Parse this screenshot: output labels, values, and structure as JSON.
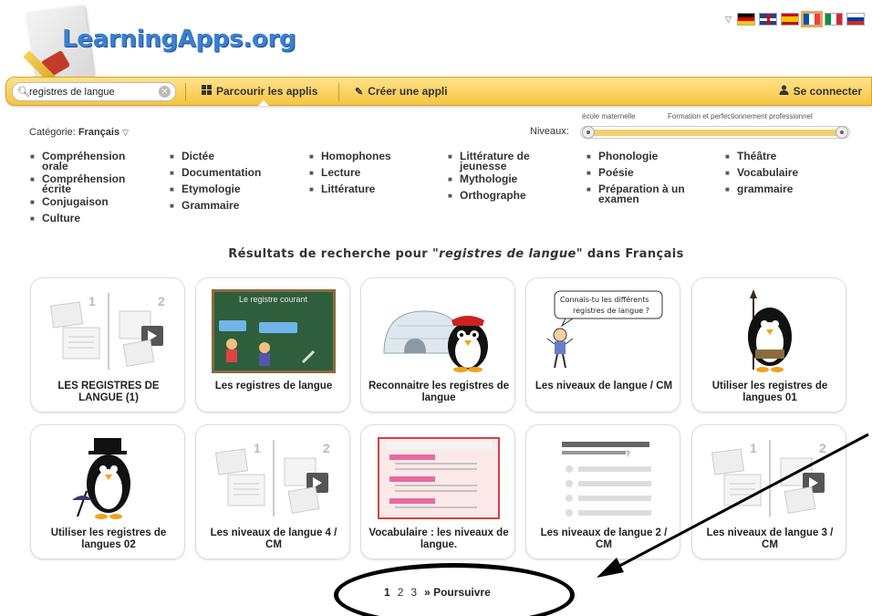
{
  "header": {
    "logo_text": "LearningApps.org",
    "flags": [
      "de",
      "gb",
      "es",
      "fr",
      "it",
      "ru"
    ]
  },
  "navbar": {
    "search_value": "registres de langue",
    "browse_label": "Parcourir les applis",
    "create_label": "Créer une appli",
    "login_label": "Se connecter"
  },
  "filters": {
    "category_prefix": "Catégorie:",
    "category_value": "Français",
    "levels_label": "Niveaux:",
    "level_min_label": "école maternelle",
    "level_max_label": "Formation et perfectionnement professionnel",
    "level_range": [
      0,
      1
    ]
  },
  "subcategories": {
    "col1": [
      "Compréhension orale",
      "Compréhension écrite",
      "Conjugaison",
      "Culture"
    ],
    "col2": [
      "Dictée",
      "Documentation",
      "Etymologie",
      "Grammaire"
    ],
    "col3": [
      "Homophones",
      "Lecture",
      "Littérature"
    ],
    "col4": [
      "Littérature de jeunesse",
      "Mythologie",
      "Orthographe"
    ],
    "col5": [
      "Phonologie",
      "Poésie",
      "Préparation à un examen"
    ],
    "col6": [
      "Théâtre",
      "Vocabulaire",
      "grammaire"
    ]
  },
  "results": {
    "prefix": "Résultats de recherche pour",
    "query": "\"registres de langue\"",
    "suffix": "dans Français"
  },
  "cards": [
    {
      "title": "LES REGISTRES DE LANGUE (1)",
      "thumb": "placeholder"
    },
    {
      "title": "Les registres de langue",
      "thumb": "chalkboard"
    },
    {
      "title": "Reconnaitre les registres de langue",
      "thumb": "igloo-penguin"
    },
    {
      "title": "Les niveaux de langue / CM",
      "thumb": "speech-bubble",
      "bubble": "Connais-tu les différents registres de langue ?"
    },
    {
      "title": "Utiliser les registres de langues 01",
      "thumb": "penguin-spear"
    },
    {
      "title": "Utiliser les registres de langues 02",
      "thumb": "penguin-hat"
    },
    {
      "title": "Les niveaux de langue 4 / CM",
      "thumb": "placeholder"
    },
    {
      "title": "Vocabulaire : les niveaux de langue.",
      "thumb": "poster"
    },
    {
      "title": "Les niveaux de langue 2 / CM",
      "thumb": "quiz"
    },
    {
      "title": "Les niveaux de langue 3 / CM",
      "thumb": "placeholder"
    }
  ],
  "pagination": {
    "current": "1",
    "pages": [
      "2",
      "3"
    ],
    "next_label": "» Poursuivre"
  }
}
